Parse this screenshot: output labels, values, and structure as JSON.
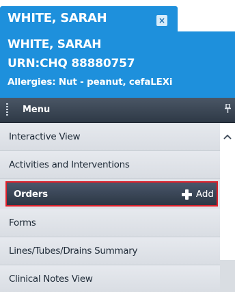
{
  "patient_tab": {
    "name": "WHITE, SARAH",
    "close_glyph": "×",
    "close_icon": "close-icon"
  },
  "banner": {
    "name": "WHITE, SARAH",
    "urn": "URN:CHQ 88880757",
    "allergies": "Allergies: Nut - peanut, cefaLEXi"
  },
  "menu": {
    "title": "Menu",
    "pin_glyph": "ꟷ",
    "pin_icon": "pin-icon",
    "items": [
      {
        "label": "Interactive View"
      },
      {
        "label": "Activities and Interventions"
      },
      {
        "label": "Orders",
        "active": true,
        "action_label": "Add",
        "action_icon": "plus-icon"
      },
      {
        "label": "Forms"
      },
      {
        "label": "Lines/Tubes/Drains Summary"
      },
      {
        "label": "Clinical Notes View"
      }
    ]
  },
  "colors": {
    "banner_blue": "#1e90dc",
    "menu_dark": "#2e3946",
    "highlight_red": "#e0202a",
    "item_bg": "#dfe3e8"
  }
}
